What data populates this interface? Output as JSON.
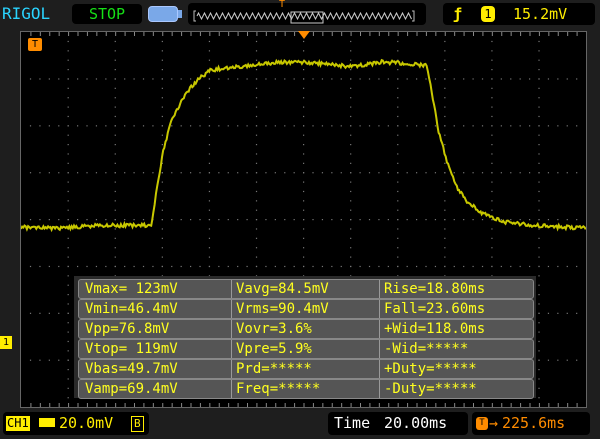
{
  "header": {
    "brand": "RIGOL",
    "run_state": "STOP",
    "trigger_edge_icon": "rising-edge-icon",
    "trigger_source": "1",
    "trigger_level": "15.2mV",
    "trigger_marker": "T"
  },
  "colors": {
    "trace": "#c8c800",
    "text_yellow": "#ffff20",
    "orange": "#ff8c00",
    "run_green": "#16e016",
    "brand_cyan": "#2ad4ff"
  },
  "measurements": [
    [
      "Vmax= 123mV",
      "Vavg=84.5mV",
      "Rise=18.80ms"
    ],
    [
      "Vmin=46.4mV",
      "Vrms=90.4mV",
      "Fall=23.60ms"
    ],
    [
      "Vpp=76.8mV",
      "Vovr=3.6%",
      "+Wid=118.0ms"
    ],
    [
      "Vtop= 119mV",
      "Vpre=5.9%",
      "-Wid=*****"
    ],
    [
      "Vbas=49.7mV",
      "Prd=*****",
      "+Duty=*****"
    ],
    [
      "Vamp=69.4mV",
      "Freq=*****",
      "-Duty=*****"
    ]
  ],
  "footer": {
    "channel": "CH1",
    "coupling_icon": "dc-coupling-icon",
    "volts_div": "20.0mV",
    "bw_limit": "B",
    "time_label": "Time",
    "time_div": "20.00ms",
    "trigger_offset_icon": "trigger-offset-icon",
    "trigger_offset": "225.6ms"
  },
  "channel_marker": "1",
  "waveform": {
    "volts_per_div_mv": 20,
    "time_per_div_ms": 20,
    "t_ms": [
      0,
      17,
      34,
      55.3,
      56.2,
      57.9,
      60.4,
      63.8,
      68.1,
      72.3,
      76.6,
      80.9,
      89.4,
      102.1,
      114.9,
      127.7,
      140.4,
      153.2,
      166,
      172.3,
      174.5,
      177.4,
      180.9,
      185.1,
      189.4,
      195.7,
      204.3,
      217,
      240.4
    ],
    "mv": [
      49.8,
      49.4,
      50.6,
      50.6,
      56.6,
      67.2,
      82.1,
      94.9,
      103.4,
      109.8,
      114,
      117,
      117.9,
      119.6,
      120.4,
      119.6,
      118.3,
      120.4,
      119.6,
      118.7,
      107.7,
      90.6,
      77.9,
      67.2,
      60.9,
      55.8,
      52.3,
      50.6,
      49.4
    ]
  }
}
